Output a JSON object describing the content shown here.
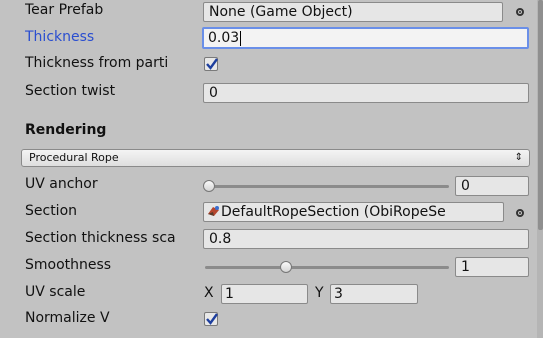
{
  "fields": {
    "tear_prefab": {
      "label": "Tear Prefab",
      "value": "None (Game Object)"
    },
    "thickness": {
      "label": "Thickness",
      "value": "0.03"
    },
    "thickness_from_particles": {
      "label": "Thickness from parti",
      "checked": true
    },
    "section_twist": {
      "label": "Section twist",
      "value": "0"
    }
  },
  "rendering": {
    "header": "Rendering",
    "mode_dropdown": "Procedural Rope",
    "uv_anchor": {
      "label": "UV anchor",
      "value": "0",
      "slider_fraction": 0.0
    },
    "section": {
      "label": "Section",
      "value": "DefaultRopeSection (ObiRopeSe"
    },
    "section_thickness_scale": {
      "label": "Section thickness sca",
      "value": "0.8"
    },
    "smoothness": {
      "label": "Smoothness",
      "value": "1",
      "slider_fraction": 0.33
    },
    "uv_scale": {
      "label": "UV scale",
      "x_label": "X",
      "x_value": "1",
      "y_label": "Y",
      "y_value": "3"
    },
    "normalize_v": {
      "label": "Normalize V",
      "checked": true
    }
  },
  "icons": {
    "object_picker": "circle-dot-icon",
    "section_asset": "rope-section-asset-icon",
    "dropdown_arrows": "updown-arrows-icon",
    "checkmark": "checkmark-icon"
  },
  "colors": {
    "active_label": "#2a4ed0",
    "focus_border": "#6a8fe8",
    "panel_bg": "#c2c2c2"
  }
}
